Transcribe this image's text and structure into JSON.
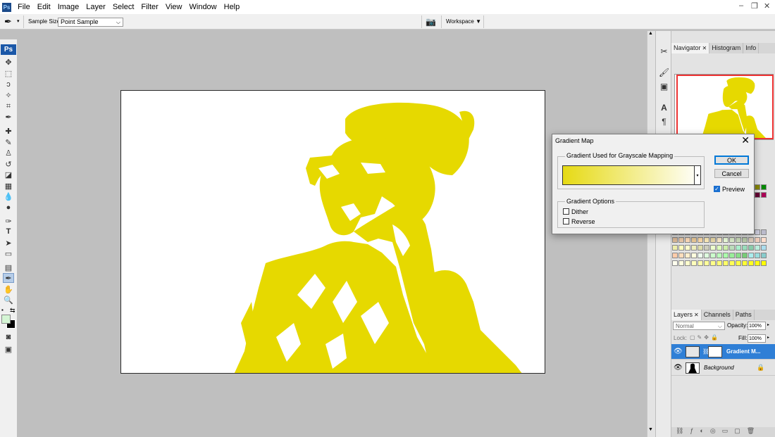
{
  "menubar": {
    "logo": "Ps",
    "items": [
      "File",
      "Edit",
      "Image",
      "Layer",
      "Select",
      "Filter",
      "View",
      "Window",
      "Help"
    ]
  },
  "options": {
    "sample_size_label": "Sample Size:",
    "sample_size_value": "Point Sample",
    "workspace_label": "Workspace"
  },
  "tools": {
    "ps_label": "Ps"
  },
  "panels": {
    "navigator_tabs": [
      "Navigator",
      "Histogram",
      "Info"
    ],
    "layers_tabs": [
      "Layers",
      "Channels",
      "Paths"
    ],
    "blend_mode": "Normal",
    "opacity_label": "Opacity:",
    "opacity_value": "100%",
    "lock_label": "Lock:",
    "fill_label": "Fill:",
    "fill_value": "100%",
    "layers": [
      {
        "name": "Gradient M...",
        "selected": true
      },
      {
        "name": "Background",
        "selected": false
      }
    ]
  },
  "dialog": {
    "title": "Gradient Map",
    "group_gradient": "Gradient Used for Grayscale Mapping",
    "group_options": "Gradient Options",
    "ok": "OK",
    "cancel": "Cancel",
    "preview": "Preview",
    "dither": "Dither",
    "reverse": "Reverse",
    "preview_checked": true,
    "dither_checked": false,
    "reverse_checked": false,
    "gradient_colors": [
      "#e6da14",
      "#ffffff"
    ]
  },
  "colors": {
    "image_yellow": "#e6d900",
    "accent_blue": "#2f7fd6"
  }
}
